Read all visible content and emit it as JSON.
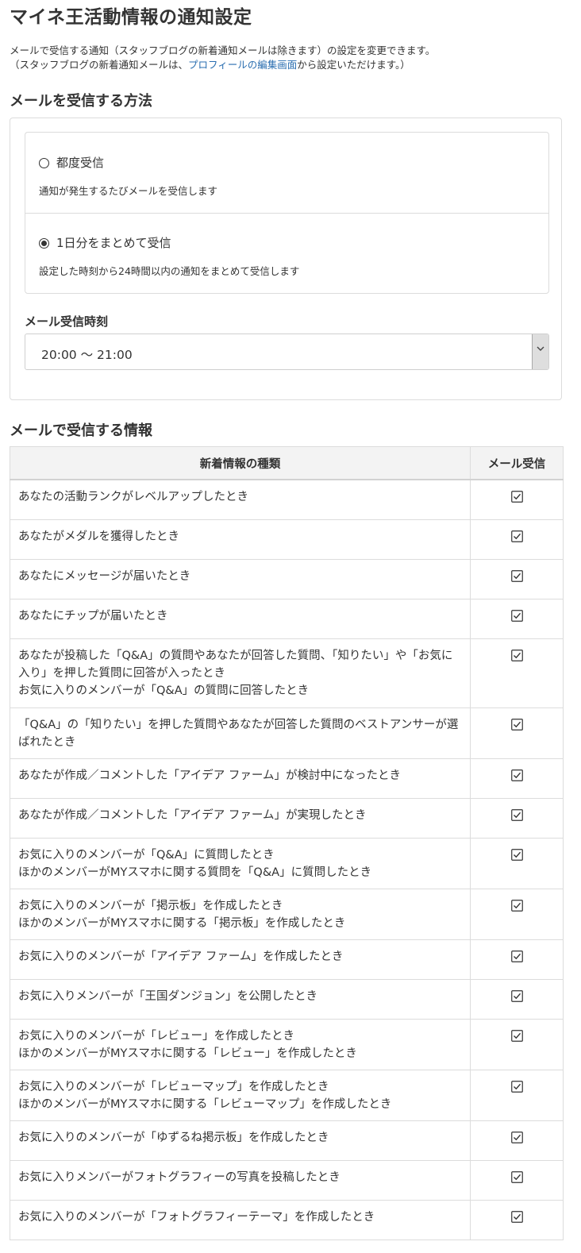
{
  "page": {
    "title": "マイネ王活動情報の通知設定",
    "intro_line1": "メールで受信する通知（スタッフブログの新着通知メールは除きます）の設定を変更できます。",
    "intro_line2_prefix": "（スタッフブログの新着通知メールは、",
    "intro_link": "プロフィールの編集画面",
    "intro_line2_suffix": "から設定いただけます。）"
  },
  "method": {
    "heading": "メールを受信する方法",
    "options": [
      {
        "label": "都度受信",
        "description": "通知が発生するたびメールを受信します",
        "selected": false
      },
      {
        "label": "1日分をまとめて受信",
        "description": "設定した時刻から24時間以内の通知をまとめて受信します",
        "selected": true
      }
    ],
    "time_label": "メール受信時刻",
    "time_value": "20:00 〜 21:00"
  },
  "info": {
    "heading": "メールで受信する情報",
    "col_type": "新着情報の種類",
    "col_mail": "メール受信",
    "rows": [
      {
        "lines": [
          "あなたの活動ランクがレベルアップしたとき"
        ],
        "checked": true
      },
      {
        "lines": [
          "あなたがメダルを獲得したとき"
        ],
        "checked": true
      },
      {
        "lines": [
          "あなたにメッセージが届いたとき"
        ],
        "checked": true
      },
      {
        "lines": [
          "あなたにチップが届いたとき"
        ],
        "checked": true
      },
      {
        "lines": [
          "あなたが投稿した「Q&A」の質問やあなたが回答した質問、「知りたい」や「お気に入り」を押した質問に回答が入ったとき",
          "お気に入りのメンバーが「Q&A」の質問に回答したとき"
        ],
        "checked": true
      },
      {
        "lines": [
          "「Q&A」の「知りたい」を押した質問やあなたが回答した質問のベストアンサーが選ばれたとき"
        ],
        "checked": true
      },
      {
        "lines": [
          "あなたが作成／コメントした「アイデア ファーム」が検討中になったとき"
        ],
        "checked": true
      },
      {
        "lines": [
          "あなたが作成／コメントした「アイデア ファーム」が実現したとき"
        ],
        "checked": true
      },
      {
        "lines": [
          "お気に入りのメンバーが「Q&A」に質問したとき",
          "ほかのメンバーがMYスマホに関する質問を「Q&A」に質問したとき"
        ],
        "checked": true
      },
      {
        "lines": [
          "お気に入りのメンバーが「掲示板」を作成したとき",
          "ほかのメンバーがMYスマホに関する「掲示板」を作成したとき"
        ],
        "checked": true
      },
      {
        "lines": [
          "お気に入りのメンバーが「アイデア ファーム」を作成したとき"
        ],
        "checked": true
      },
      {
        "lines": [
          "お気に入りメンバーが「王国ダンジョン」を公開したとき"
        ],
        "checked": true
      },
      {
        "lines": [
          "お気に入りのメンバーが「レビュー」を作成したとき",
          "ほかのメンバーがMYスマホに関する「レビュー」を作成したとき"
        ],
        "checked": true
      },
      {
        "lines": [
          "お気に入りのメンバーが「レビューマップ」を作成したとき",
          "ほかのメンバーがMYスマホに関する「レビューマップ」を作成したとき"
        ],
        "checked": true
      },
      {
        "lines": [
          "お気に入りのメンバーが「ゆずるね掲示板」を作成したとき"
        ],
        "checked": true
      },
      {
        "lines": [
          "お気に入りメンバーがフォトグラフィーの写真を投稿したとき"
        ],
        "checked": true
      },
      {
        "lines": [
          "お気に入りのメンバーが「フォトグラフィーテーマ」を作成したとき"
        ],
        "checked": true
      }
    ]
  }
}
